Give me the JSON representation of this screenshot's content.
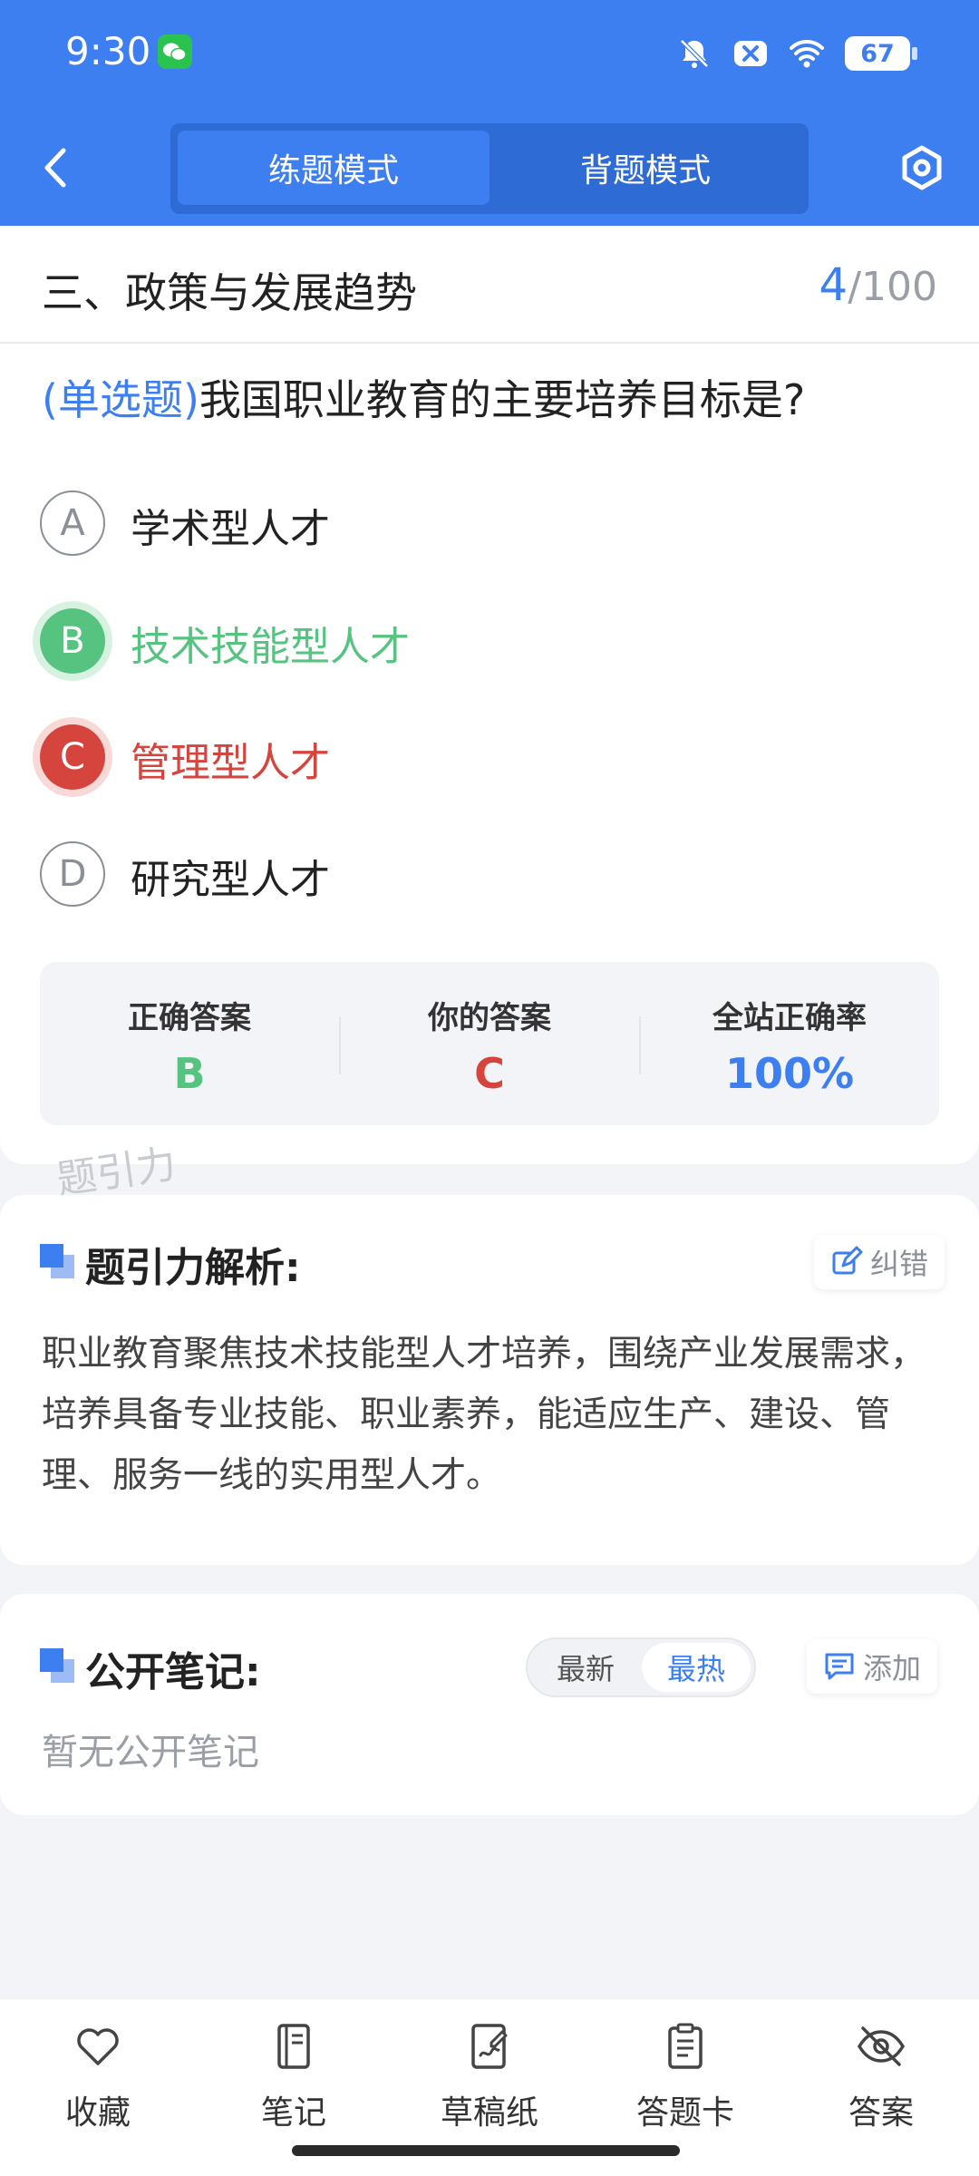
{
  "status_bar": {
    "time": "9:30",
    "battery": "67"
  },
  "header": {
    "modes": [
      {
        "label": "练题模式",
        "active": true
      },
      {
        "label": "背题模式",
        "active": false
      }
    ]
  },
  "section": {
    "title": "三、政策与发展趋势",
    "current": "4",
    "total": "/100"
  },
  "question": {
    "type": "(单选题)",
    "text": "我国职业教育的主要培养目标是?",
    "options": [
      {
        "letter": "A",
        "text": "学术型人才",
        "state": "normal"
      },
      {
        "letter": "B",
        "text": "技术技能型人才",
        "state": "correct"
      },
      {
        "letter": "C",
        "text": "管理型人才",
        "state": "wrong"
      },
      {
        "letter": "D",
        "text": "研究型人才",
        "state": "normal"
      }
    ]
  },
  "answer_summary": {
    "correct_label": "正确答案",
    "correct_value": "B",
    "yours_label": "你的答案",
    "yours_value": "C",
    "rate_label": "全站正确率",
    "rate_value": "100%"
  },
  "watermark": "题引力",
  "analysis": {
    "title": "题引力解析:",
    "report_label": "纠错",
    "text": "职业教育聚焦技术技能型人才培养，围绕产业发展需求，培养具备专业技能、职业素养，能适应生产、建设、管理、服务一线的实用型人才。"
  },
  "notes": {
    "title": "公开笔记:",
    "sort_latest": "最新",
    "sort_hot": "最热",
    "add_label": "添加",
    "empty_text": "暂无公开笔记"
  },
  "bottom_nav": [
    {
      "label": "收藏",
      "icon": "heart-icon"
    },
    {
      "label": "笔记",
      "icon": "notebook-icon"
    },
    {
      "label": "草稿纸",
      "icon": "draft-icon"
    },
    {
      "label": "答题卡",
      "icon": "clipboard-icon"
    },
    {
      "label": "答案",
      "icon": "eye-off-icon"
    }
  ],
  "colors": {
    "primary": "#3d7ff0",
    "correct": "#56c480",
    "wrong": "#d6443e"
  }
}
